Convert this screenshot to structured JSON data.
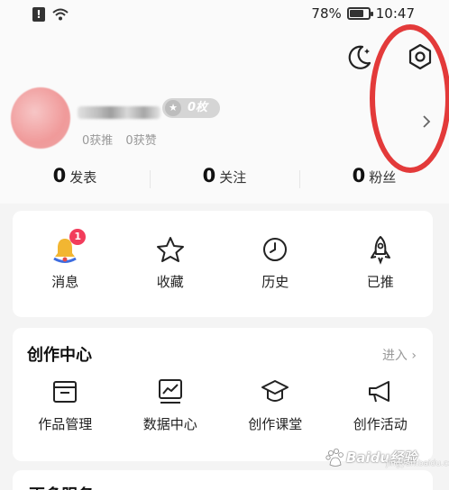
{
  "status_bar": {
    "battery": "78%",
    "battery_level": 0.78,
    "time": "10:47"
  },
  "profile": {
    "badge_count": "0枚",
    "received_recommend": "0获推",
    "received_likes": "0获赞"
  },
  "stats": [
    {
      "num": "0",
      "label": "发表"
    },
    {
      "num": "0",
      "label": "关注"
    },
    {
      "num": "0",
      "label": "粉丝"
    }
  ],
  "quick_actions": [
    {
      "label": "消息",
      "icon": "bell-icon",
      "badge": "1"
    },
    {
      "label": "收藏",
      "icon": "star-icon"
    },
    {
      "label": "历史",
      "icon": "clock-icon"
    },
    {
      "label": "已推",
      "icon": "rocket-icon"
    }
  ],
  "creation_center": {
    "title": "创作中心",
    "enter_label": "进入 ›",
    "items": [
      {
        "label": "作品管理",
        "icon": "folder-icon"
      },
      {
        "label": "数据中心",
        "icon": "chart-icon"
      },
      {
        "label": "创作课堂",
        "icon": "graduation-cap-icon"
      },
      {
        "label": "创作活动",
        "icon": "megaphone-icon"
      }
    ]
  },
  "next_section": {
    "title": "更多服务"
  },
  "watermark": {
    "text": "Baidu经验",
    "sub": "jingyan.baidu.com"
  },
  "colors": {
    "highlight_circle": "#e33a3a",
    "notification_badge": "#f23c5b"
  }
}
